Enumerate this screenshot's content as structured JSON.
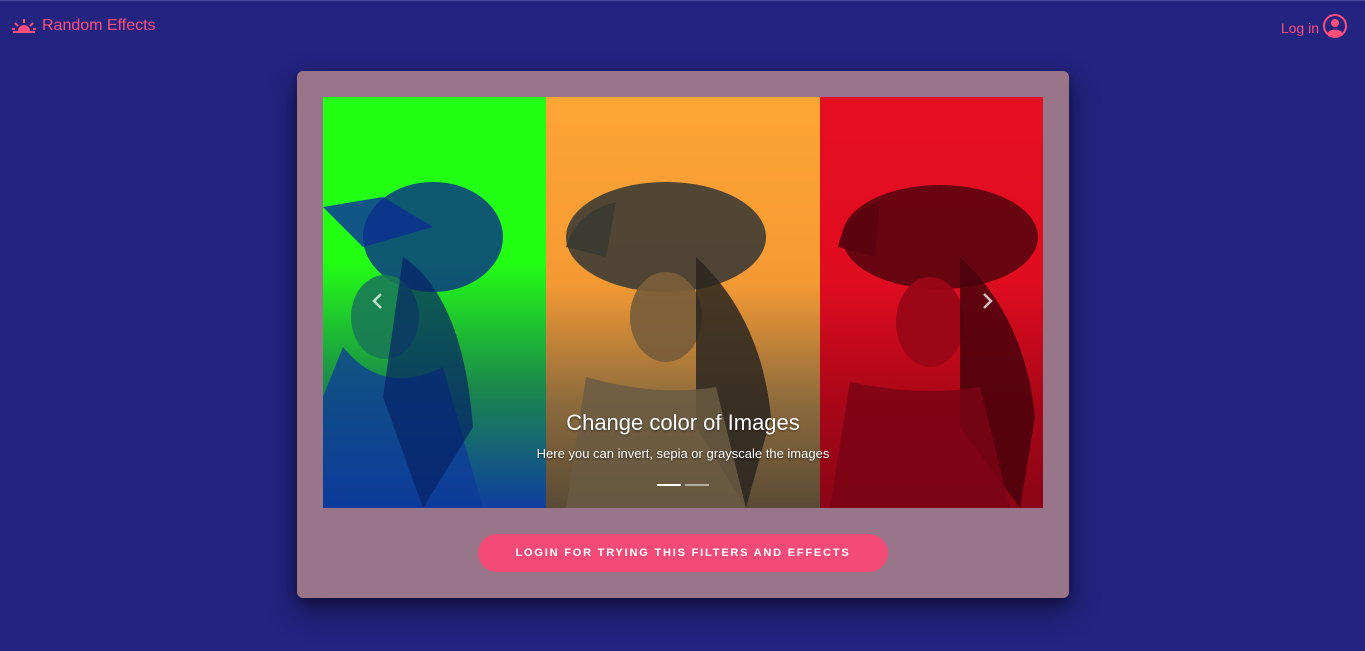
{
  "navbar": {
    "brand_label": "Random Effects",
    "brand_icon": "sunrise-icon",
    "login_label": "Log in",
    "login_icon": "account-circle-icon"
  },
  "carousel": {
    "slides": [
      {
        "title": "Change color of Images",
        "subtitle": "Here you can invert, sepia or grayscale the images"
      }
    ],
    "active_index": 0,
    "indicator_count": 2,
    "prev_icon": "chevron-left-icon",
    "next_icon": "chevron-right-icon"
  },
  "cta": {
    "label": "LOGIN FOR TRYING THIS FILTERS AND EFFECTS"
  },
  "colors": {
    "background": "#232380",
    "accent": "#ff4d7a",
    "card": "#987589",
    "button": "#f34a78",
    "panel_green": "#22ff14",
    "panel_orange": "#fda534",
    "panel_red": "#e60f22"
  }
}
